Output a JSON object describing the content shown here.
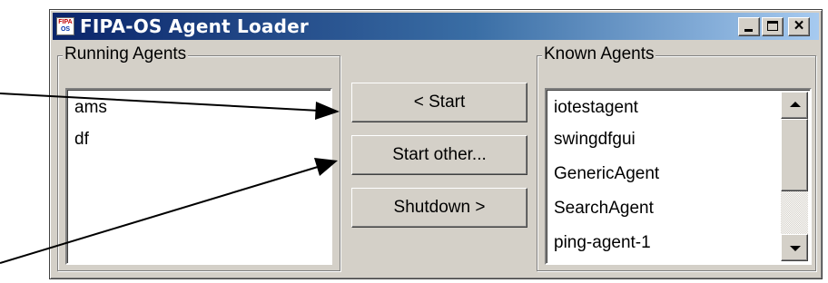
{
  "window": {
    "title": "FIPA-OS Agent Loader",
    "icon_name": "fipa-os-app-icon",
    "icon_text_top": "FIPA",
    "icon_text_bottom": "OS",
    "controls": {
      "minimize": "minimize-icon",
      "maximize": "maximize-icon",
      "close": "close-icon",
      "close_glyph": "×"
    }
  },
  "running_agents": {
    "label": "Running Agents",
    "items": [
      "ams",
      "df"
    ]
  },
  "buttons": {
    "start": "< Start",
    "start_other": "Start other...",
    "shutdown": "Shutdown >"
  },
  "known_agents": {
    "label": "Known Agents",
    "items": [
      "iotestagent",
      "swingdfgui",
      "GenericAgent",
      "SearchAgent",
      "ping-agent-1"
    ],
    "scrollbar": {
      "up_icon": "scroll-up-icon",
      "down_icon": "scroll-down-icon"
    }
  },
  "annotations": {
    "arrows": [
      "annotation-arrow-to-start",
      "annotation-arrow-to-start-other"
    ],
    "color": "#000000"
  }
}
